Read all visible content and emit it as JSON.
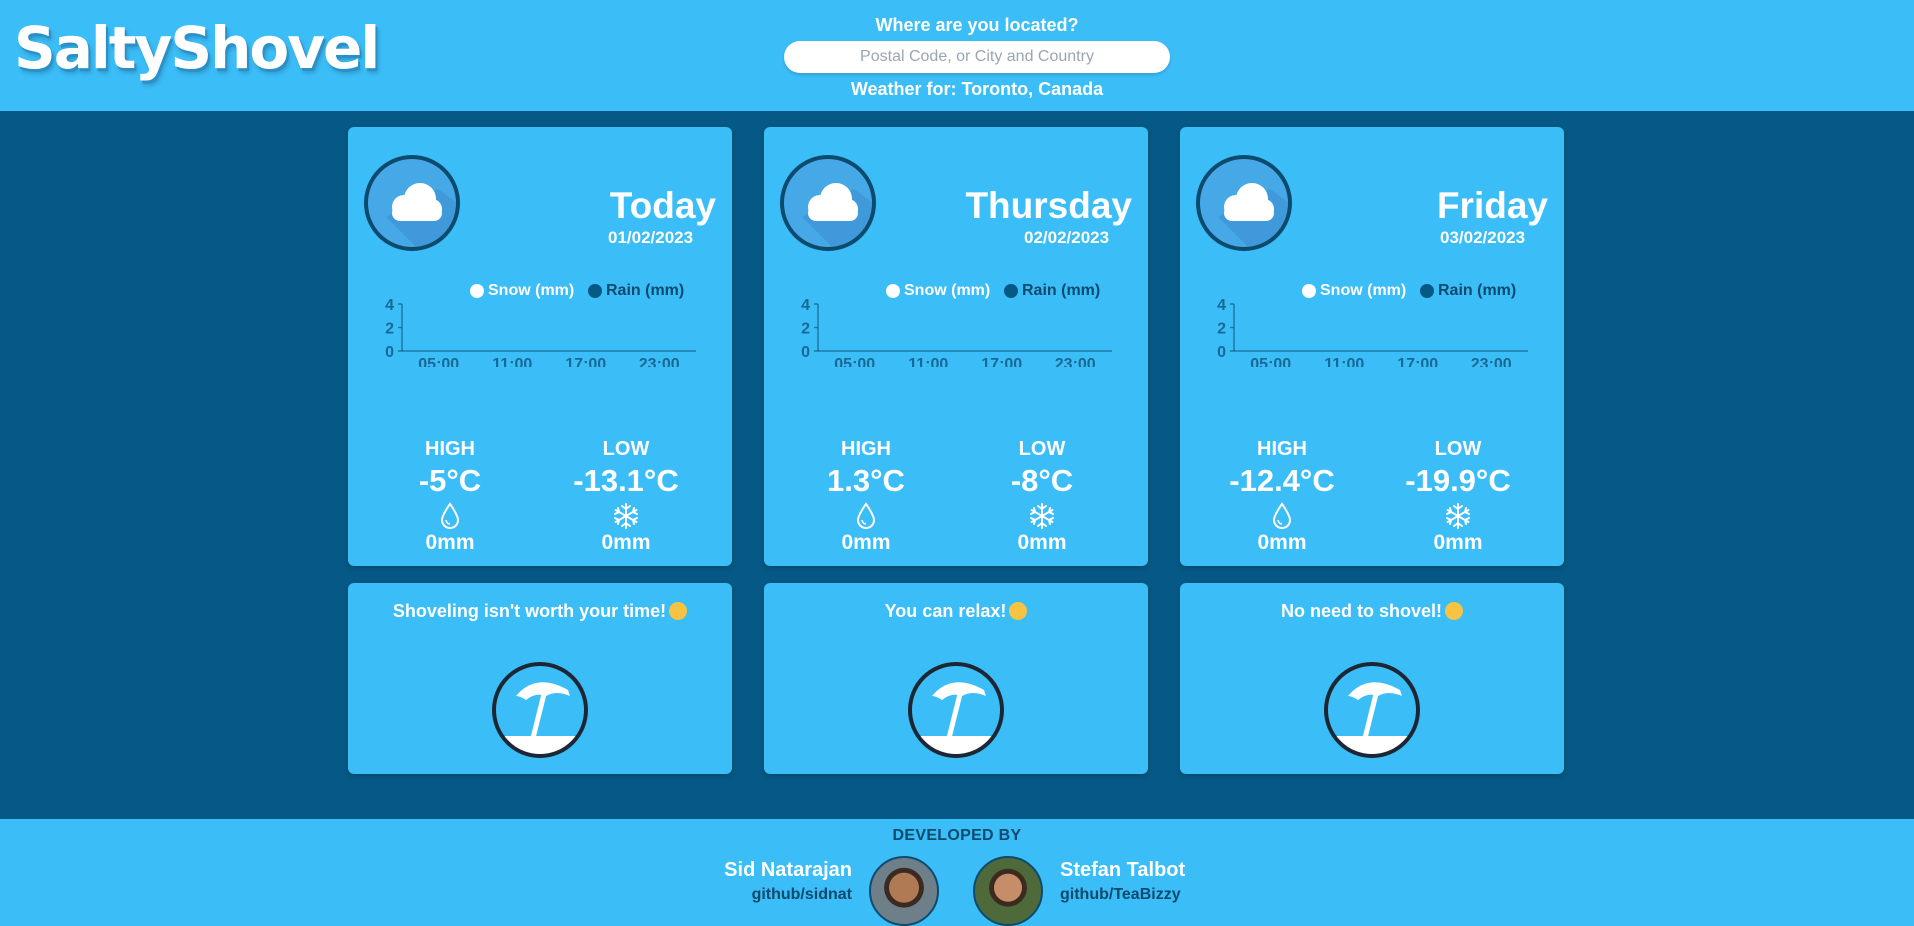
{
  "header": {
    "logo": "SaltyShovel",
    "search_label": "Where are you located?",
    "search_placeholder": "Postal Code, or City and Country",
    "search_value": "",
    "weather_for": "Weather for: Toronto, Canada"
  },
  "legend": {
    "snow": "Snow (mm)",
    "rain": "Rain (mm)"
  },
  "colors": {
    "header_bg": "#3bbdf8",
    "page_bg": "#065986",
    "card_bg": "#3bbdf8",
    "rain_dot": "#075985",
    "snow_dot": "#ffffff"
  },
  "days": [
    {
      "name": "Today",
      "date": "01/02/2023",
      "icon": "cloud-icon",
      "high_label": "HIGH",
      "high": "-5°C",
      "rain": "0mm",
      "low_label": "LOW",
      "low": "-13.1°C",
      "snow": "0mm",
      "advice": "Shoveling isn't worth your time!",
      "advice_icon": "beach-umbrella-icon"
    },
    {
      "name": "Thursday",
      "date": "02/02/2023",
      "icon": "cloud-icon",
      "high_label": "HIGH",
      "high": "1.3°C",
      "rain": "0mm",
      "low_label": "LOW",
      "low": "-8°C",
      "snow": "0mm",
      "advice": "You can relax!",
      "advice_icon": "beach-umbrella-icon"
    },
    {
      "name": "Friday",
      "date": "03/02/2023",
      "icon": "cloud-icon",
      "high_label": "HIGH",
      "high": "-12.4°C",
      "rain": "0mm",
      "low_label": "LOW",
      "low": "-19.9°C",
      "snow": "0mm",
      "advice": "No need to shovel!",
      "advice_icon": "beach-umbrella-icon"
    }
  ],
  "chart_data": [
    {
      "type": "bar",
      "categories": [
        "05:00",
        "11:00",
        "17:00",
        "23:00"
      ],
      "series": [
        {
          "name": "Snow (mm)",
          "values": [
            0,
            0,
            0,
            0
          ]
        },
        {
          "name": "Rain (mm)",
          "values": [
            0,
            0,
            0,
            0
          ]
        }
      ],
      "yticks": [
        "0",
        "2",
        "4"
      ],
      "ylim": [
        0,
        4
      ],
      "legend": "top"
    },
    {
      "type": "bar",
      "categories": [
        "05:00",
        "11:00",
        "17:00",
        "23:00"
      ],
      "series": [
        {
          "name": "Snow (mm)",
          "values": [
            0,
            0,
            0,
            0
          ]
        },
        {
          "name": "Rain (mm)",
          "values": [
            0,
            0,
            0,
            0
          ]
        }
      ],
      "yticks": [
        "0",
        "2",
        "4"
      ],
      "ylim": [
        0,
        4
      ],
      "legend": "top"
    },
    {
      "type": "bar",
      "categories": [
        "05:00",
        "11:00",
        "17:00",
        "23:00"
      ],
      "series": [
        {
          "name": "Snow (mm)",
          "values": [
            0,
            0,
            0,
            0
          ]
        },
        {
          "name": "Rain (mm)",
          "values": [
            0,
            0,
            0,
            0
          ]
        }
      ],
      "yticks": [
        "0",
        "2",
        "4"
      ],
      "ylim": [
        0,
        4
      ],
      "legend": "top"
    }
  ],
  "footer": {
    "label": "DEVELOPED BY",
    "dev1": {
      "name": "Sid Natarajan",
      "link": "github/sidnat"
    },
    "dev2": {
      "name": "Stefan Talbot",
      "link": "github/TeaBizzy"
    }
  }
}
